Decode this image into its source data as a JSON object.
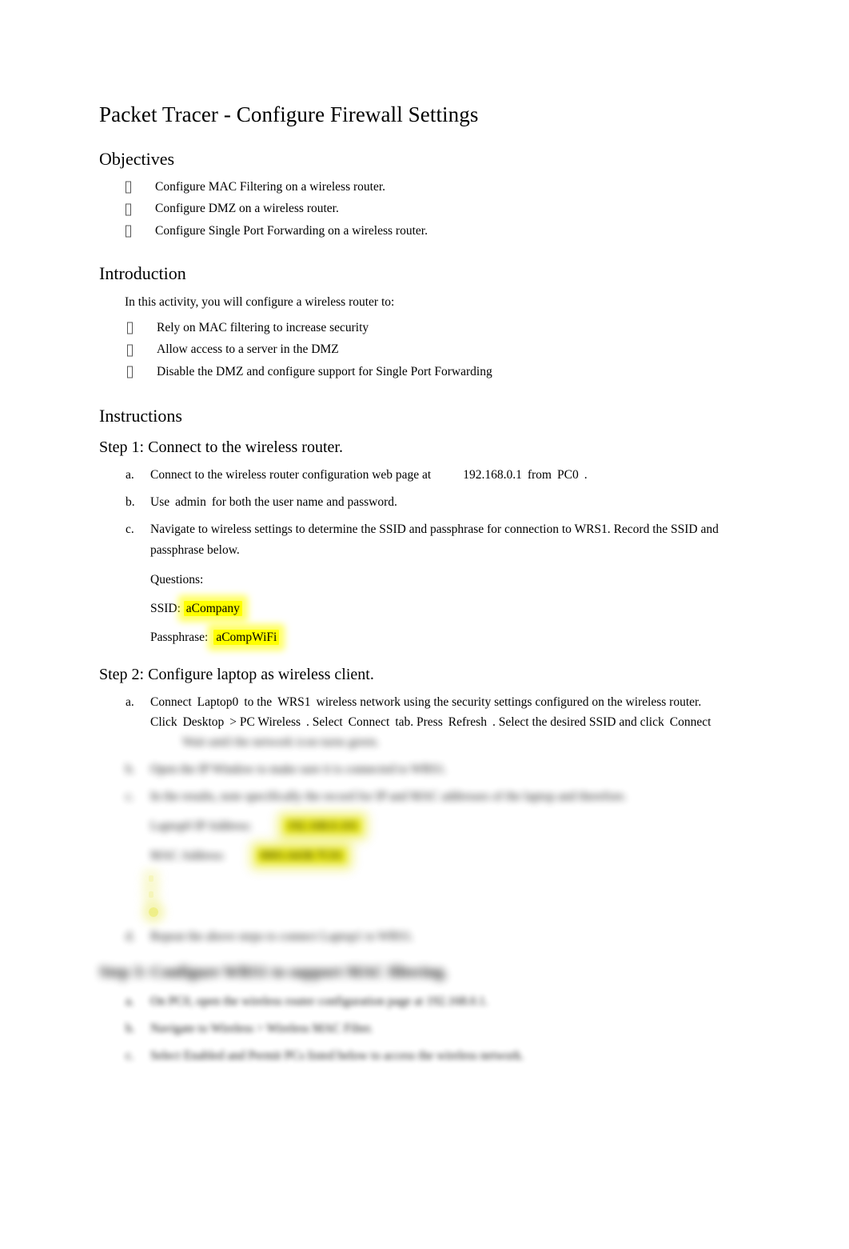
{
  "document": {
    "title": "Packet Tracer - Configure Firewall Settings"
  },
  "objectives": {
    "heading": "Objectives",
    "items": [
      "Configure MAC Filtering on a wireless router.",
      "Configure DMZ on a wireless router.",
      "Configure Single Port Forwarding on a wireless router."
    ]
  },
  "introduction": {
    "heading": "Introduction",
    "lead": "In this activity, you will configure a wireless router to:",
    "items": [
      "Rely on MAC filtering to increase security",
      "Allow access to a server in the DMZ",
      "Disable the DMZ and configure support for Single Port Forwarding"
    ]
  },
  "instructions": {
    "heading": "Instructions"
  },
  "step1": {
    "heading": "Step 1: Connect to the wireless router.",
    "items": {
      "a": {
        "marker": "a.",
        "text_before": "Connect to the wireless router configuration web page at",
        "ip": "192.168.0.1",
        "text_mid": "from",
        "host": "PC0",
        "text_after": "."
      },
      "b": {
        "marker": "b.",
        "text_before": "Use",
        "credential": "admin",
        "text_after": "for both the user name and password."
      },
      "c": {
        "marker": "c.",
        "line1": "Navigate to wireless settings to determine the SSID and passphrase for connection to WRS1.",
        "line2": "Record the SSID and passphrase below."
      }
    },
    "questions": {
      "label": "Questions:",
      "ssid_label": "SSID:",
      "ssid_answer": "aCompany",
      "passphrase_label": "Passphrase:",
      "passphrase_answer": "aCompWiFi"
    }
  },
  "step2": {
    "heading": "Step 2: Configure laptop as wireless client.",
    "item_a": {
      "marker": "a.",
      "t1": "Connect",
      "device": "Laptop0",
      "t2": "to the",
      "network": "WRS1",
      "t3": "wireless network using the security settings configured on the wireless router. Click",
      "menu1": "Desktop",
      "t4": "> PC Wireless",
      "t5": ". Select",
      "tab": "Connect",
      "t6": "tab. Press",
      "button": "Refresh",
      "t7": ". Select the desired SSID and click",
      "button2": "Connect",
      "obscured_tail": "Wait until the network icon turns green."
    },
    "item_b": {
      "marker": "b.",
      "obscured": "Open the IP Window to make sure it is connected to WRS1."
    },
    "item_c": {
      "marker": "c.",
      "obscured_line1": "In the results, note specifically the record for IP and MAC addresses of the laptop and",
      "obscured_line2": "therefore.",
      "answers": [
        {
          "label": "Laptop0 IP Address:",
          "value": "192.168.0.101"
        },
        {
          "label": "MAC Address:",
          "value": "0001.6438.7C01"
        }
      ]
    },
    "item_d": {
      "marker": "d.",
      "obscured": "Repeat the above steps to connect Laptop1 to WRS1."
    }
  },
  "step3": {
    "heading": "Step 3: Configure WRS1 to support MAC filtering.",
    "items": [
      {
        "marker": "a.",
        "obscured": "On PC0, open the wireless router configuration page at 192.168.0.1."
      },
      {
        "marker": "b.",
        "obscured": "Navigate to Wireless > Wireless MAC Filter."
      },
      {
        "marker": "c.",
        "obscured": "Select Enabled and Permit PCs listed below to access the wireless network."
      }
    ]
  },
  "colors": {
    "highlight": "#ffff00",
    "text": "#000000",
    "page_background": "#ffffff"
  }
}
